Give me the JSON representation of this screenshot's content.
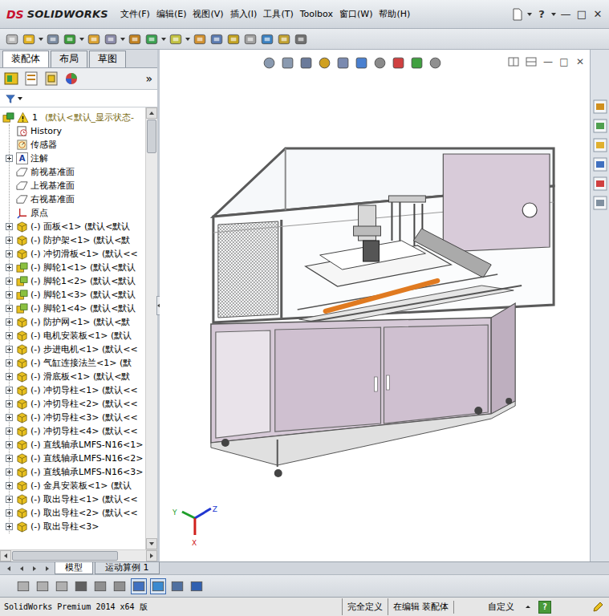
{
  "app": {
    "logo_mark": "DS",
    "logo": "SOLIDWORKS"
  },
  "menu": [
    "文件(F)",
    "编辑(E)",
    "视图(V)",
    "插入(I)",
    "工具(T)",
    "Toolbox",
    "窗口(W)",
    "帮助(H)"
  ],
  "title_controls": [
    "?",
    "—",
    "□",
    "✕"
  ],
  "panel_tabs": [
    {
      "label": "装配体",
      "selected": true
    },
    {
      "label": "布局",
      "selected": false
    },
    {
      "label": "草图",
      "selected": false
    }
  ],
  "panel_more": "»",
  "tree": {
    "root": {
      "number": "1",
      "label": "(默认<默认_显示状态-",
      "warning": true
    },
    "items": [
      {
        "label": "History",
        "kind": "history",
        "expandable": false,
        "expanded": false
      },
      {
        "label": "传感器",
        "kind": "sensor",
        "expandable": false,
        "expanded": false
      },
      {
        "label": "注解",
        "kind": "annotation",
        "glyph": "A",
        "expandable": true,
        "expanded": false
      },
      {
        "label": "前视基准面",
        "kind": "plane",
        "expandable": false,
        "expanded": false
      },
      {
        "label": "上视基准面",
        "kind": "plane",
        "expandable": false,
        "expanded": false
      },
      {
        "label": "右视基准面",
        "kind": "plane",
        "expandable": false,
        "expanded": false
      },
      {
        "label": "原点",
        "kind": "origin",
        "expandable": false,
        "expanded": false
      },
      {
        "label": "(-) 面板<1> (默认<默认",
        "kind": "part",
        "expandable": true,
        "expanded": false
      },
      {
        "label": "(-) 防护架<1> (默认<默",
        "kind": "part",
        "expandable": true,
        "expanded": false
      },
      {
        "label": "(-) 冲切滑板<1> (默认<<",
        "kind": "part",
        "expandable": true,
        "expanded": false
      },
      {
        "label": "(-) 脚轮1<1> (默认<默认",
        "kind": "assembly",
        "expandable": true,
        "expanded": false
      },
      {
        "label": "(-) 脚轮1<2> (默认<默认",
        "kind": "assembly",
        "expandable": true,
        "expanded": false
      },
      {
        "label": "(-) 脚轮1<3> (默认<默认",
        "kind": "assembly",
        "expandable": true,
        "expanded": false
      },
      {
        "label": "(-) 脚轮1<4> (默认<默认",
        "kind": "assembly",
        "expandable": true,
        "expanded": false
      },
      {
        "label": "(-) 防护网<1> (默认<默",
        "kind": "part",
        "expandable": true,
        "expanded": false
      },
      {
        "label": "(-) 电机安装板<1> (默认",
        "kind": "part",
        "expandable": true,
        "expanded": false
      },
      {
        "label": "(-) 步进电机<1> (默认<<",
        "kind": "part",
        "expandable": true,
        "expanded": false
      },
      {
        "label": "(-) 气缸连接法兰<1> (默",
        "kind": "part",
        "expandable": true,
        "expanded": false
      },
      {
        "label": "(-) 滑底板<1> (默认<默",
        "kind": "part",
        "expandable": true,
        "expanded": false
      },
      {
        "label": "(-) 冲切导柱<1> (默认<<",
        "kind": "part",
        "expandable": true,
        "expanded": false
      },
      {
        "label": "(-) 冲切导柱<2> (默认<<",
        "kind": "part",
        "expandable": true,
        "expanded": false
      },
      {
        "label": "(-) 冲切导柱<3> (默认<<",
        "kind": "part",
        "expandable": true,
        "expanded": false
      },
      {
        "label": "(-) 冲切导柱<4> (默认<<",
        "kind": "part",
        "expandable": true,
        "expanded": false
      },
      {
        "label": "(-) 直线轴承LMFS-N16<1>",
        "kind": "part",
        "expandable": true,
        "expanded": false
      },
      {
        "label": "(-) 直线轴承LMFS-N16<2>",
        "kind": "part",
        "expandable": true,
        "expanded": false
      },
      {
        "label": "(-) 直线轴承LMFS-N16<3>",
        "kind": "part",
        "expandable": true,
        "expanded": false
      },
      {
        "label": "(-) 金具安装板<1> (默认",
        "kind": "part",
        "expandable": true,
        "expanded": false
      },
      {
        "label": "(-) 取出导柱<1> (默认<<",
        "kind": "part",
        "expandable": true,
        "expanded": false
      },
      {
        "label": "(-) 取出导柱<2> (默认<<",
        "kind": "part",
        "expandable": true,
        "expanded": false
      },
      {
        "label": "(-) 取出导柱<3>",
        "kind": "part",
        "expandable": true,
        "expanded": false
      }
    ]
  },
  "graphics_controls": [
    "—",
    "□",
    "✕"
  ],
  "triad": [
    {
      "label": "Y",
      "color": "#1e9e2a"
    },
    {
      "label": "Z",
      "color": "#2137d0"
    },
    {
      "label": "X",
      "color": "#d0201c"
    }
  ],
  "bottom_tabs": [
    {
      "label": "模型",
      "selected": true
    },
    {
      "label": "运动算例 1",
      "selected": false
    }
  ],
  "status_bar": {
    "product": "SolidWorks Premium 2014 x64 版",
    "fields": [
      "完全定义",
      "在编辑 装配体"
    ],
    "custom": "自定义",
    "help": "?"
  }
}
